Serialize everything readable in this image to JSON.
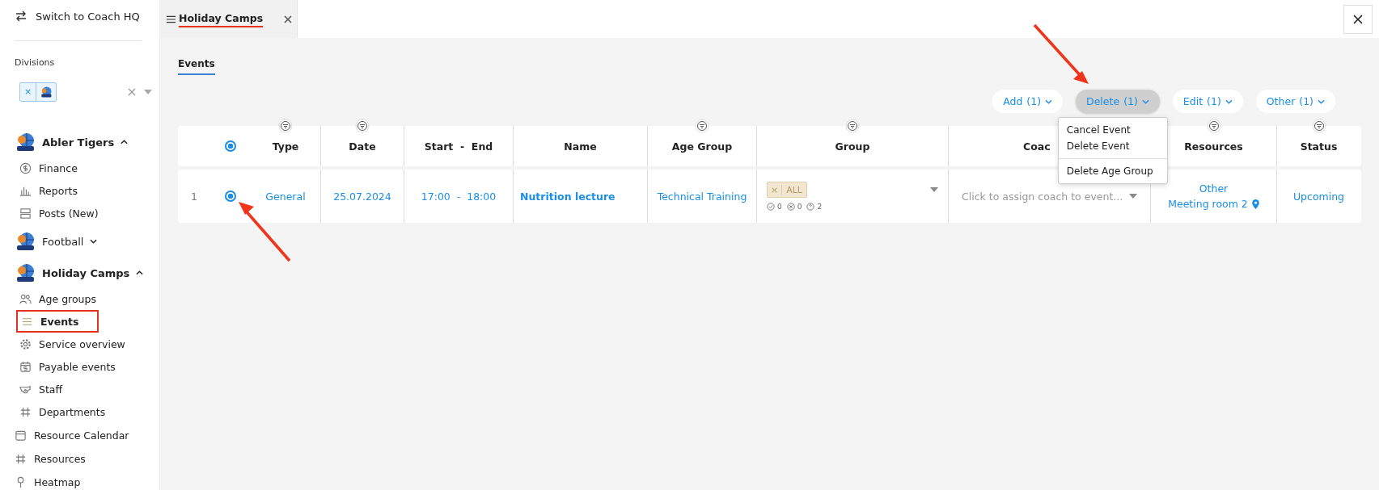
{
  "sidebar": {
    "switch_label": "Switch to Coach HQ",
    "divisions_label": "Divisions",
    "division_tag": {
      "remove": "×"
    },
    "groups": [
      {
        "name": "Abler Tigers",
        "expanded": true,
        "items": [
          {
            "label": "Finance",
            "highlighted": false
          },
          {
            "label": "Reports",
            "highlighted": false
          },
          {
            "label": "Posts (New)",
            "highlighted": false
          }
        ]
      },
      {
        "name": "Football",
        "expanded": false
      },
      {
        "name": "Holiday Camps",
        "expanded": true,
        "items": [
          {
            "label": "Age groups",
            "highlighted": false
          },
          {
            "label": "Events",
            "highlighted": true
          },
          {
            "label": "Service overview",
            "highlighted": false
          },
          {
            "label": "Payable events",
            "highlighted": false
          },
          {
            "label": "Staff",
            "highlighted": false
          },
          {
            "label": "Departments",
            "highlighted": false
          }
        ]
      }
    ],
    "bottom_items": [
      {
        "label": "Resource Calendar"
      },
      {
        "label": "Resources"
      },
      {
        "label": "Heatmap"
      }
    ]
  },
  "tabs": [
    {
      "label": "Holiday Camps",
      "selected": true
    }
  ],
  "subtabs": [
    {
      "label": "Events",
      "selected": true
    }
  ],
  "actions": [
    {
      "label": "Add",
      "count": "(1)",
      "open": false
    },
    {
      "label": "Delete",
      "count": "(1)",
      "open": true
    },
    {
      "label": "Edit",
      "count": "(1)",
      "open": false
    },
    {
      "label": "Other",
      "count": "(1)",
      "open": false
    }
  ],
  "menu": {
    "sections": [
      [
        "Cancel Event",
        "Delete Event"
      ],
      [
        "Delete Age Group"
      ]
    ]
  },
  "table": {
    "header_radio_selected": true,
    "columns": [
      {
        "label": "Type",
        "filter": true
      },
      {
        "label": "Date",
        "filter": true
      },
      {
        "label": "Start  -  End",
        "filter": false
      },
      {
        "label": "Name",
        "filter": false
      },
      {
        "label": "Age Group",
        "filter": true
      },
      {
        "label": "Group",
        "filter": true
      },
      {
        "label": "Coac",
        "filter": false
      },
      {
        "label": "Resources",
        "filter": true
      },
      {
        "label": "Status",
        "filter": true
      }
    ],
    "rows": [
      {
        "number": "1",
        "selected": true,
        "type": "General",
        "date": "25.07.2024",
        "time": "17:00  -  18:00",
        "name": "Nutrition lecture",
        "age_group": "Technical Training",
        "group_tag": {
          "remove": "×",
          "label": "ALL"
        },
        "group_counts": [
          "0",
          "0",
          "2"
        ],
        "coach_placeholder": "Click to assign coach to event...",
        "resources": [
          "Other",
          "Meeting room 2"
        ],
        "status": "Upcoming"
      }
    ]
  }
}
